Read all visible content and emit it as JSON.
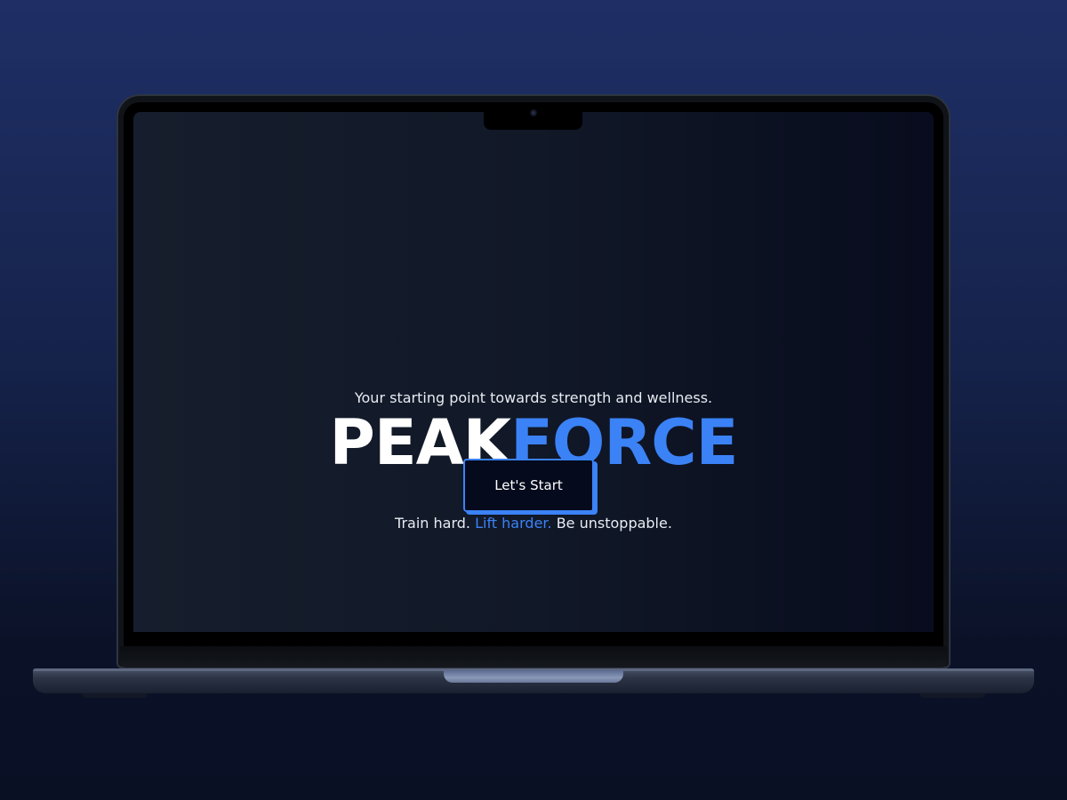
{
  "hero": {
    "tagline": "Your starting point towards strength and wellness.",
    "brand_part1": "PEAK",
    "brand_part2": "FORCE",
    "motto_part1": "Train hard. ",
    "motto_highlight": "Lift harder.",
    "motto_part2": " Be unstoppable.",
    "cta_label": "Let's Start"
  },
  "colors": {
    "accent": "#3b82f6",
    "screen_bg": "#111827",
    "page_bg": "#1f2f66"
  },
  "icons": {
    "camera": "camera-icon"
  }
}
